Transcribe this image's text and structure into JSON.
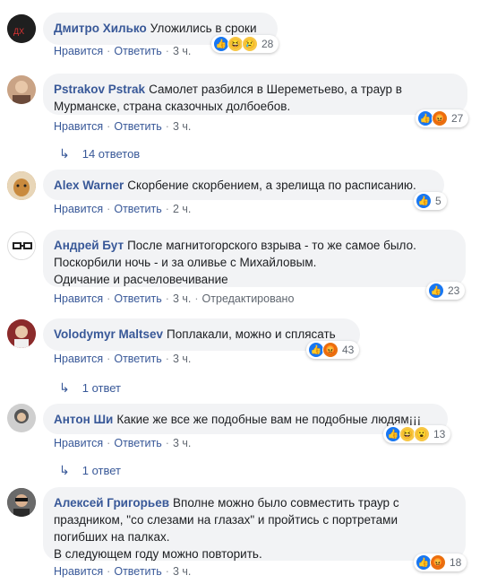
{
  "labels": {
    "like": "Нравится",
    "reply": "Ответить",
    "edited": "Отредактировано"
  },
  "comments": [
    {
      "author": "Дмитро Хилько",
      "text": "Уложились в сроки",
      "time": "3 ч.",
      "reactions_count": "28",
      "reactions": [
        "like-icon",
        "haha-icon",
        "sad-icon"
      ]
    },
    {
      "author": "Pstrakov Pstrak",
      "text": "Самолет разбился в Шереметьево, а траур в Мурманске, страна сказочных долбоебов.",
      "time": "3 ч.",
      "reactions_count": "27",
      "reactions": [
        "like-icon",
        "angry-icon"
      ],
      "replies": "14 ответов"
    },
    {
      "author": "Alex Warner",
      "text": "Скорбение скорбением, а зрелища по расписанию.",
      "time": "2 ч.",
      "reactions_count": "5",
      "reactions": [
        "like-icon"
      ]
    },
    {
      "author": "Андрей Бут",
      "text_lines": [
        "После магнитогорского взрыва - то же самое было.",
        "Поскорбили ночь - и за оливье с Михайловым.",
        "Одичание и расчеловечивание"
      ],
      "time": "3 ч.",
      "reactions_count": "23",
      "reactions": [
        "like-icon"
      ]
    },
    {
      "author": "Volodymyr Maltsev",
      "text": "Поплакали, можно и сплясать",
      "time": "3 ч.",
      "reactions_count": "43",
      "reactions": [
        "like-icon",
        "angry-icon"
      ],
      "replies": "1 ответ"
    },
    {
      "author": "Антон Ши",
      "text": "Какие же все же подобные вам не подобные людям¡¡¡",
      "time": "3 ч.",
      "reactions_count": "13",
      "reactions": [
        "like-icon",
        "haha-icon",
        "wow-icon"
      ],
      "replies": "1 ответ"
    },
    {
      "author": "Алексей Григорьев",
      "text_lines": [
        "Вполне можно было совместить траур с",
        "праздником, \"со слезами на глазах\" и пройтись с портретами",
        "погибших на палках.",
        "В следующем году можно повторить."
      ],
      "time": "3 ч.",
      "reactions_count": "18",
      "reactions": [
        "like-icon",
        "angry-icon"
      ]
    }
  ]
}
